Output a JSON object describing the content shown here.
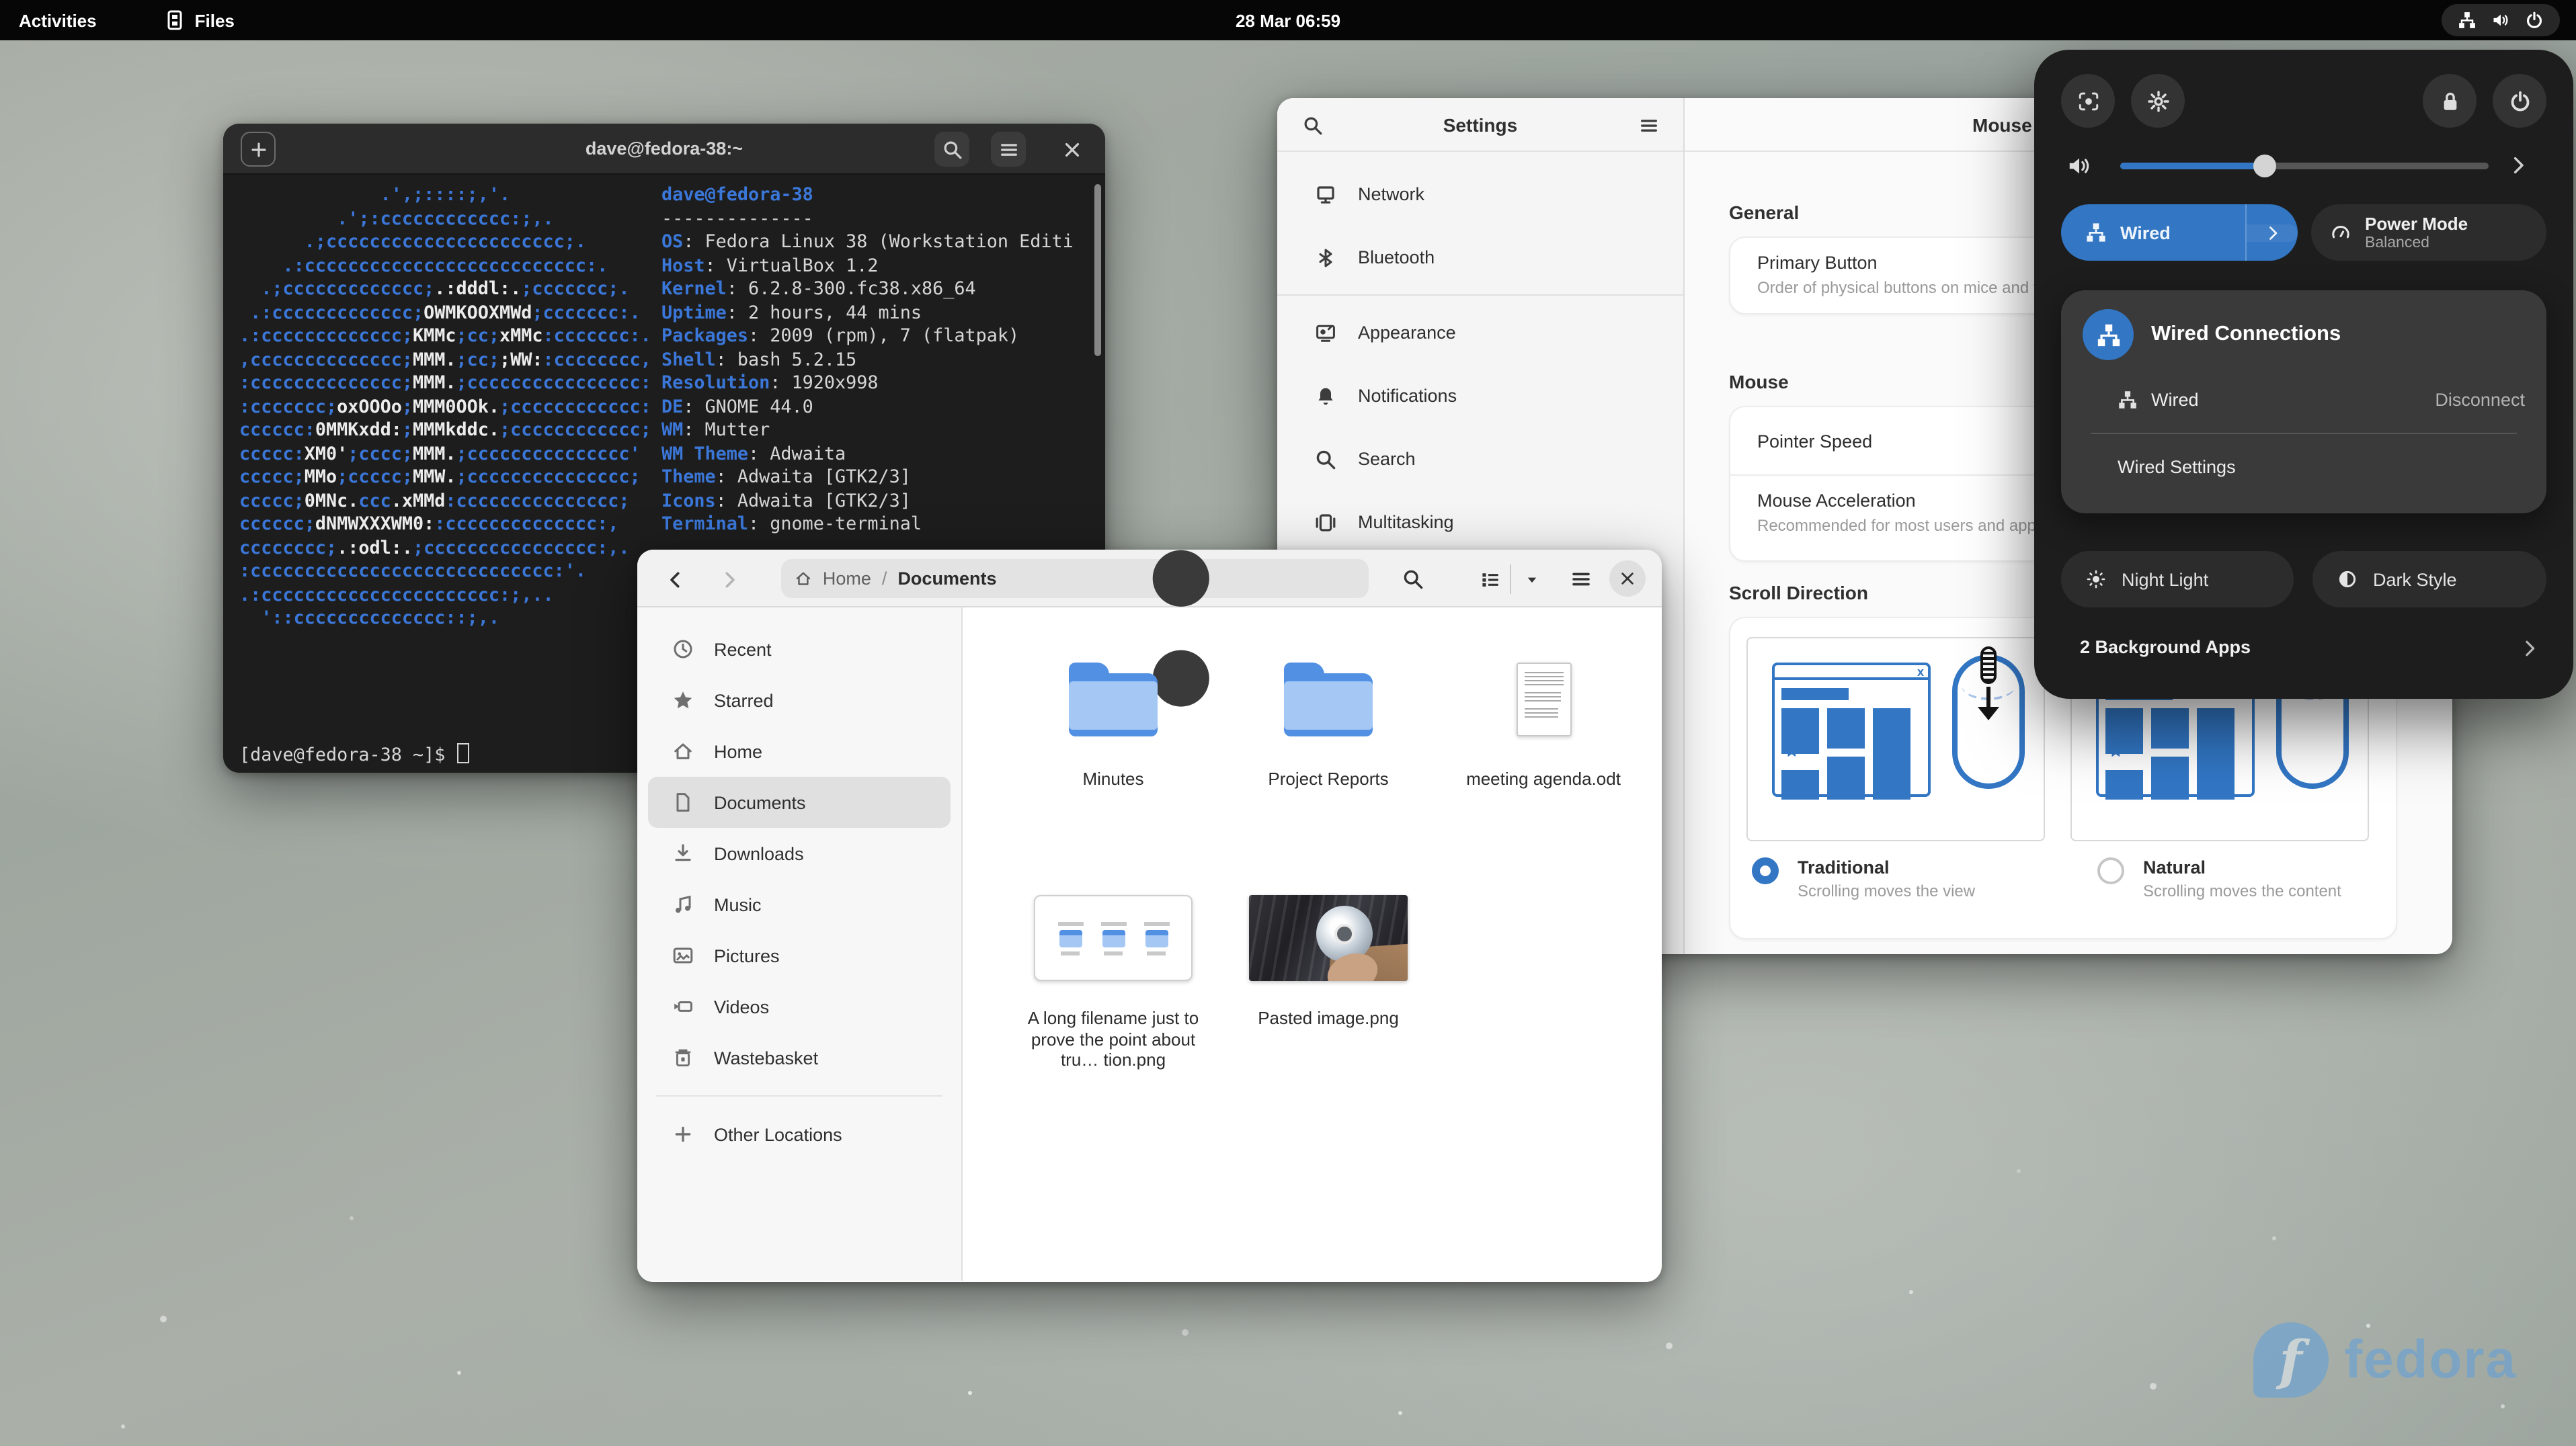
{
  "colors": {
    "accent": "#3276c4",
    "terminal_blue": "#3b77d8",
    "folder_light": "#a4c7f4",
    "folder_dark": "#5290e4",
    "fedora_blue": "#5ea0dc"
  },
  "topbar": {
    "activities": "Activities",
    "app_label": "Files",
    "clock": "28 Mar  06:59"
  },
  "wallpaper": {
    "brand": "fedora",
    "logo_glyph": "f"
  },
  "terminal": {
    "title": "dave@fedora-38:~",
    "user_line": "dave@fedora-38",
    "sep_line": "--------------",
    "info": [
      {
        "k": "OS",
        "v": "Fedora Linux 38 (Workstation Editi"
      },
      {
        "k": "Host",
        "v": "VirtualBox 1.2"
      },
      {
        "k": "Kernel",
        "v": "6.2.8-300.fc38.x86_64"
      },
      {
        "k": "Uptime",
        "v": "2 hours, 44 mins"
      },
      {
        "k": "Packages",
        "v": "2009 (rpm), 7 (flatpak)"
      },
      {
        "k": "Shell",
        "v": "bash 5.2.15"
      },
      {
        "k": "Resolution",
        "v": "1920x998"
      },
      {
        "k": "DE",
        "v": "GNOME 44.0"
      },
      {
        "k": "WM",
        "v": "Mutter"
      },
      {
        "k": "WM Theme",
        "v": "Adwaita"
      },
      {
        "k": "Theme",
        "v": "Adwaita [GTK2/3]"
      },
      {
        "k": "Icons",
        "v": "Adwaita [GTK2/3]"
      },
      {
        "k": "Terminal",
        "v": "gnome-terminal"
      }
    ],
    "art": [
      [
        [
          "b",
          "             .',;::::;,'."
        ]
      ],
      [
        [
          "b",
          "         .';:cccccccccccc:;,."
        ]
      ],
      [
        [
          "b",
          "      .;cccccccccccccccccccccc;."
        ]
      ],
      [
        [
          "b",
          "    .:cccccccccccccccccccccccccc:."
        ]
      ],
      [
        [
          "b",
          "  .;ccccccccccccc;"
        ],
        [
          "w",
          ".:dddl:."
        ],
        [
          "b",
          ";ccccccc;."
        ]
      ],
      [
        [
          "b",
          " .:ccccccccccccc;"
        ],
        [
          "w",
          "OWMKOOXMWd"
        ],
        [
          "b",
          ";ccccccc:."
        ]
      ],
      [
        [
          "b",
          ".:ccccccccccccc;"
        ],
        [
          "w",
          "KMMc"
        ],
        [
          "b",
          ";cc;"
        ],
        [
          "w",
          "xMMc"
        ],
        [
          "b",
          ":ccccccc:."
        ]
      ],
      [
        [
          "b",
          ",cccccccccccccc;"
        ],
        [
          "w",
          "MMM."
        ],
        [
          "b",
          ";cc;"
        ],
        [
          "w",
          ";WW:"
        ],
        [
          "b",
          ":cccccccc,"
        ]
      ],
      [
        [
          "b",
          ":cccccccccccccc;"
        ],
        [
          "w",
          "MMM."
        ],
        [
          "b",
          ";cccccccccccccccc:"
        ]
      ],
      [
        [
          "b",
          ":ccccccc;"
        ],
        [
          "w",
          "oxOOOo"
        ],
        [
          "b",
          ";"
        ],
        [
          "w",
          "MMM0OOk."
        ],
        [
          "b",
          ";cccccccccccc:"
        ]
      ],
      [
        [
          "b",
          "cccccc:"
        ],
        [
          "w",
          "0MMKxdd:"
        ],
        [
          "b",
          ";"
        ],
        [
          "w",
          "MMMkddc."
        ],
        [
          "b",
          ";cccccccccccc;"
        ]
      ],
      [
        [
          "b",
          "ccccc:"
        ],
        [
          "w",
          "XM0'"
        ],
        [
          "b",
          ";cccc;"
        ],
        [
          "w",
          "MMM."
        ],
        [
          "b",
          ";ccccccccccccccc'"
        ]
      ],
      [
        [
          "b",
          "ccccc;"
        ],
        [
          "w",
          "MMo"
        ],
        [
          "b",
          ";ccccc;"
        ],
        [
          "w",
          "MMW."
        ],
        [
          "b",
          ";ccccccccccccccc;"
        ]
      ],
      [
        [
          "b",
          "ccccc;"
        ],
        [
          "w",
          "0MNc."
        ],
        [
          "b",
          "ccc"
        ],
        [
          "w",
          ".xMMd"
        ],
        [
          "b",
          ":ccccccccccccccc;"
        ]
      ],
      [
        [
          "b",
          "cccccc;"
        ],
        [
          "w",
          "dNMWXXXWM0:"
        ],
        [
          "b",
          ":cccccccccccccc:,"
        ]
      ],
      [
        [
          "b",
          "cccccccc;"
        ],
        [
          "w",
          ".:odl:."
        ],
        [
          "b",
          ";cccccccccccccccc:,."
        ]
      ],
      [
        [
          "b",
          ":cccccccccccccccccccccccccccc:'."
        ]
      ],
      [
        [
          "b",
          ".:cccccccccccccccccccccc:;,.."
        ]
      ],
      [
        [
          "b",
          "  '::cccccccccccccc::;,."
        ]
      ]
    ],
    "prompt": "[dave@fedora-38 ~]$"
  },
  "settings": {
    "title": "Settings",
    "sidebar": [
      {
        "icon": "netdisplay",
        "label": "Network"
      },
      {
        "icon": "bluetooth",
        "label": "Bluetooth"
      },
      {
        "divider": true
      },
      {
        "icon": "appearance",
        "label": "Appearance"
      },
      {
        "icon": "bell",
        "label": "Notifications"
      },
      {
        "icon": "magnifier",
        "label": "Search"
      },
      {
        "icon": "multitasking",
        "label": "Multitasking"
      }
    ],
    "page_title": "Mouse",
    "general_label": "General",
    "primary_button": {
      "title": "Primary Button",
      "subtitle": "Order of physical buttons on mice and to"
    },
    "mouse_label": "Mouse",
    "pointer_speed": "Pointer Speed",
    "mouse_accel": {
      "title": "Mouse Acceleration",
      "subtitle": "Recommended for most users and applic"
    },
    "scroll_label": "Scroll Direction",
    "traditional": {
      "label": "Traditional",
      "desc": "Scrolling moves the view",
      "selected": true
    },
    "natural": {
      "label": "Natural",
      "desc": "Scrolling moves the content",
      "selected": false
    }
  },
  "files": {
    "path": {
      "home": "Home",
      "sep": "/",
      "current": "Documents"
    },
    "sidebar": [
      {
        "icon": "clock",
        "label": "Recent"
      },
      {
        "icon": "star",
        "label": "Starred"
      },
      {
        "icon": "home",
        "label": "Home"
      },
      {
        "icon": "document",
        "label": "Documents",
        "selected": true
      },
      {
        "icon": "download",
        "label": "Downloads"
      },
      {
        "icon": "music",
        "label": "Music"
      },
      {
        "icon": "picture",
        "label": "Pictures"
      },
      {
        "icon": "video",
        "label": "Videos"
      },
      {
        "icon": "trash",
        "label": "Wastebasket"
      },
      {
        "divider": true
      },
      {
        "icon": "plus",
        "label": "Other Locations"
      }
    ],
    "items": [
      {
        "name": "Minutes",
        "type": "folder"
      },
      {
        "name": "Project Reports",
        "type": "folder"
      },
      {
        "name": "meeting agenda.odt",
        "type": "document"
      },
      {
        "name": "A long filename just to prove the point about tru…  tion.png",
        "type": "screenshot"
      },
      {
        "name": "Pasted image.png",
        "type": "photo"
      }
    ]
  },
  "quick": {
    "volume_percent": 39,
    "wired_button": "Wired",
    "power_mode": {
      "title": "Power Mode",
      "subtitle": "Balanced"
    },
    "popover": {
      "title": "Wired Connections",
      "row": {
        "label": "Wired",
        "action": "Disconnect"
      },
      "settings_link": "Wired Settings"
    },
    "night_light": "Night Light",
    "dark_style": "Dark Style",
    "background_apps": "2 Background Apps"
  }
}
